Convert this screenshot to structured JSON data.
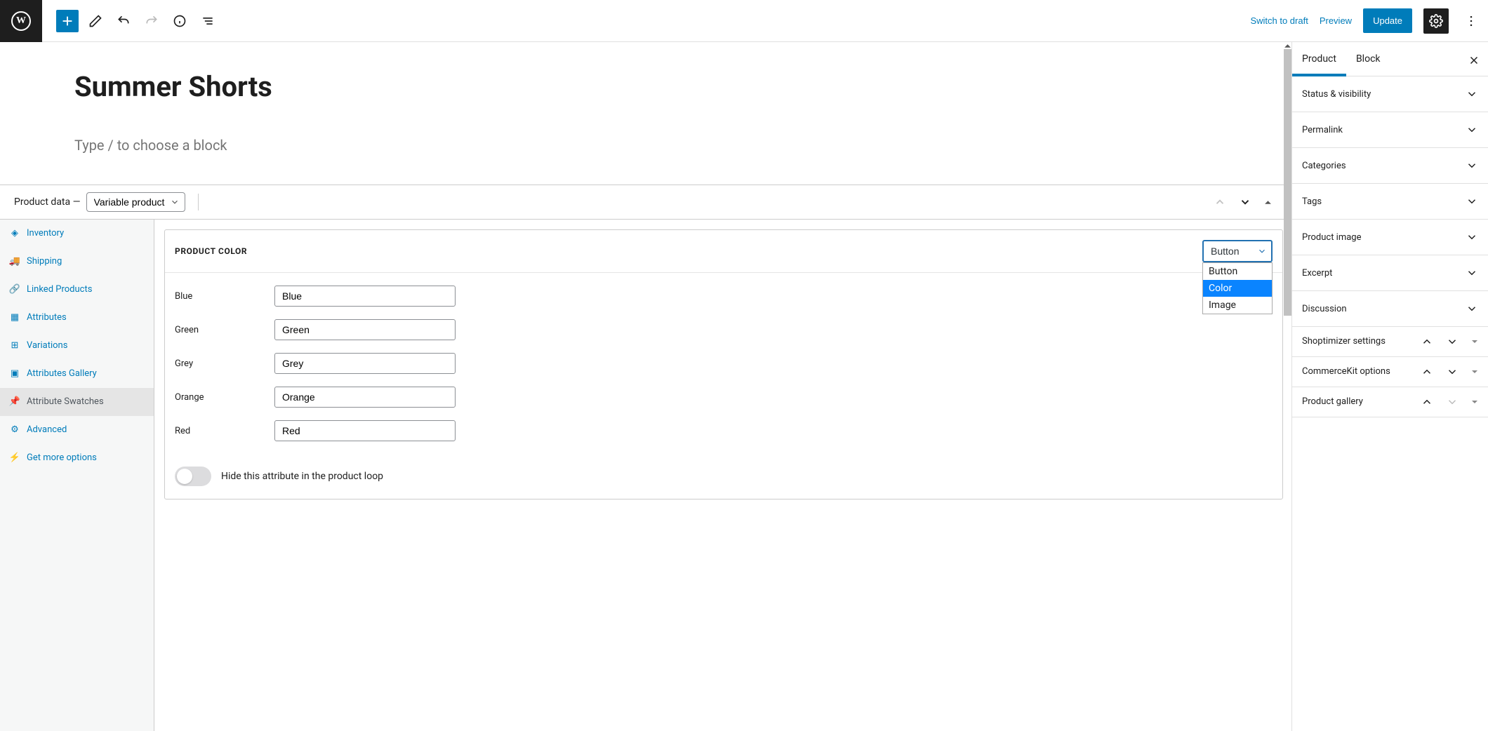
{
  "toolbar": {
    "switch_to_draft": "Switch to draft",
    "preview": "Preview",
    "update": "Update"
  },
  "post": {
    "title": "Summer Shorts",
    "block_placeholder": "Type / to choose a block"
  },
  "product_data": {
    "label": "Product data —",
    "select_value": "Variable product",
    "tabs": {
      "inventory": "Inventory",
      "shipping": "Shipping",
      "linked_products": "Linked Products",
      "attributes": "Attributes",
      "variations": "Variations",
      "attributes_gallery": "Attributes Gallery",
      "attribute_swatches": "Attribute Swatches",
      "advanced": "Advanced",
      "get_more_options": "Get more options"
    },
    "panel": {
      "title": "PRODUCT COLOR",
      "type_select_value": "Button",
      "type_options": [
        "Button",
        "Color",
        "Image"
      ],
      "type_highlighted_option": "Color",
      "rows": [
        {
          "label": "Blue",
          "value": "Blue"
        },
        {
          "label": "Green",
          "value": "Green"
        },
        {
          "label": "Grey",
          "value": "Grey"
        },
        {
          "label": "Orange",
          "value": "Orange"
        },
        {
          "label": "Red",
          "value": "Red"
        }
      ],
      "hide_toggle_label": "Hide this attribute in the product loop"
    }
  },
  "sidebar": {
    "tabs": {
      "product": "Product",
      "block": "Block"
    },
    "sections": {
      "status_visibility": "Status & visibility",
      "permalink": "Permalink",
      "categories": "Categories",
      "tags": "Tags",
      "product_image": "Product image",
      "excerpt": "Excerpt",
      "discussion": "Discussion",
      "shoptimizer": "Shoptimizer settings",
      "commercekit": "CommerceKit options",
      "product_gallery": "Product gallery"
    }
  }
}
